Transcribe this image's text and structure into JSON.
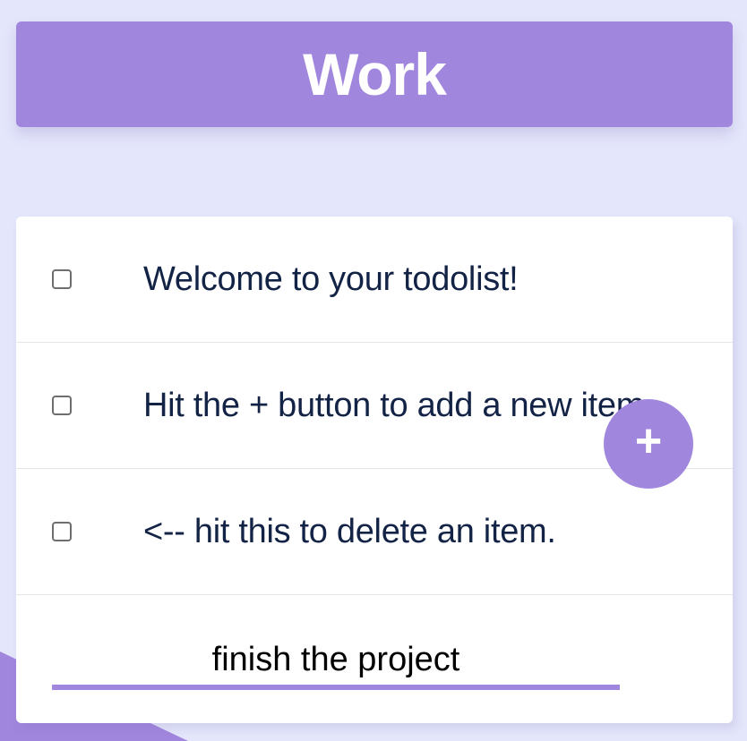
{
  "header": {
    "title": "Work"
  },
  "items": [
    {
      "text": "Welcome to your todolist!",
      "checked": false
    },
    {
      "text": "Hit the + button to add a new item.",
      "checked": false
    },
    {
      "text": "<-- hit this to delete an item.",
      "checked": false
    }
  ],
  "new_item": {
    "value": "finish the project"
  },
  "add_button": {
    "label": "+"
  },
  "colors": {
    "accent": "#A186DE",
    "background": "#E4E6FB",
    "text": "#132346"
  }
}
